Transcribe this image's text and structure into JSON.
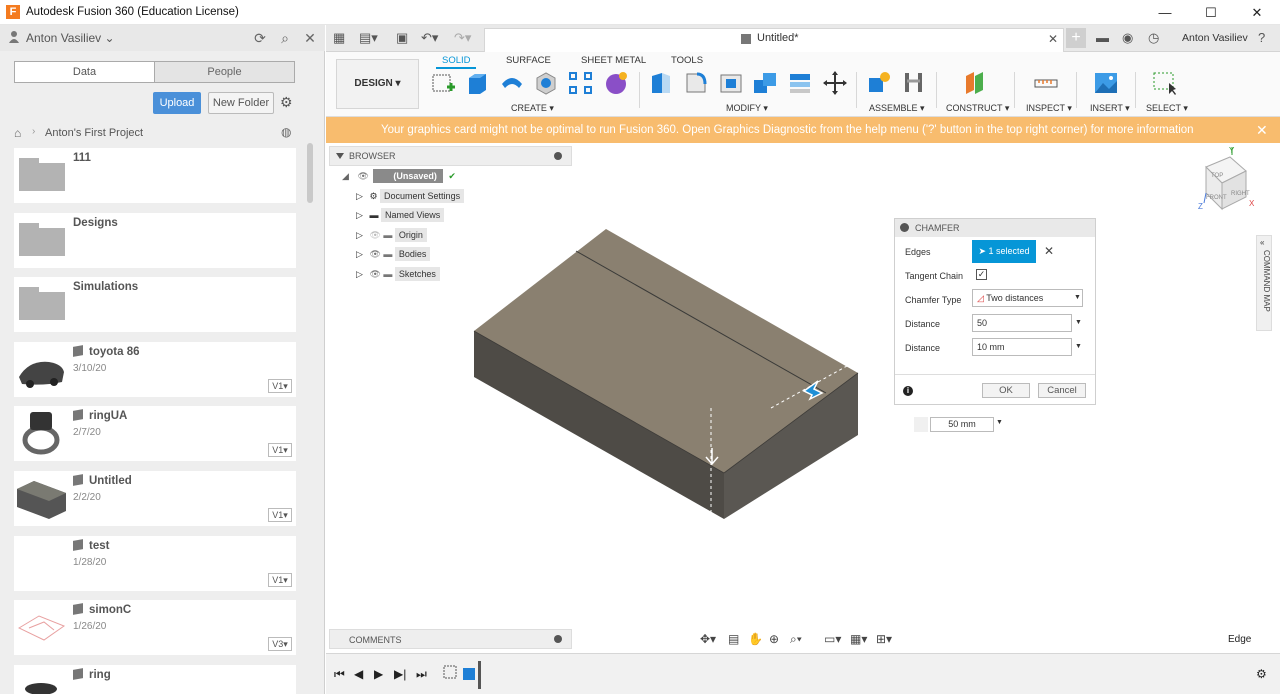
{
  "window": {
    "title": "Autodesk Fusion 360 (Education License)",
    "logo_letter": "F",
    "minimize": "—",
    "maximize": "☐",
    "close": "✕"
  },
  "left_panel": {
    "user": "Anton Vasiliev",
    "tabs": {
      "data": "Data",
      "people": "People"
    },
    "upload_label": "Upload",
    "new_folder_label": "New Folder",
    "breadcrumb": "Anton's First Project",
    "items": [
      {
        "name": "111",
        "date": "",
        "version": "",
        "kind": "folder"
      },
      {
        "name": "Designs",
        "date": "",
        "version": "",
        "kind": "folder"
      },
      {
        "name": "Simulations",
        "date": "",
        "version": "",
        "kind": "folder"
      },
      {
        "name": "toyota 86",
        "date": "3/10/20",
        "version": "V1",
        "kind": "design"
      },
      {
        "name": "ringUA",
        "date": "2/7/20",
        "version": "V1",
        "kind": "design"
      },
      {
        "name": "Untitled",
        "date": "2/2/20",
        "version": "V1",
        "kind": "design"
      },
      {
        "name": "test",
        "date": "1/28/20",
        "version": "V1",
        "kind": "design"
      },
      {
        "name": "simonC",
        "date": "1/26/20",
        "version": "V3",
        "kind": "design"
      },
      {
        "name": "ring",
        "date": "",
        "version": "",
        "kind": "design"
      }
    ]
  },
  "tabbar": {
    "doc_title": "Untitled*",
    "doc_close": "✕",
    "plus": "+",
    "user": "Anton Vasiliev"
  },
  "toolbar": {
    "workspace": "DESIGN ▾",
    "ribbon_tabs": [
      "SOLID",
      "SURFACE",
      "SHEET METAL",
      "TOOLS"
    ],
    "groups": [
      "CREATE ▾",
      "MODIFY ▾",
      "ASSEMBLE ▾",
      "CONSTRUCT ▾",
      "INSPECT ▾",
      "INSERT ▾",
      "SELECT ▾"
    ]
  },
  "warning": {
    "message": "Your graphics card might not be optimal to run Fusion 360. Open Graphics Diagnostic from the help menu ('?' button in the top right corner) for more information",
    "close": "✕"
  },
  "browser": {
    "title": "BROWSER",
    "root": "(Unsaved)",
    "nodes": [
      "Document Settings",
      "Named Views",
      "Origin",
      "Bodies",
      "Sketches"
    ],
    "comments": "COMMENTS"
  },
  "chamfer": {
    "title": "CHAMFER",
    "edges_label": "Edges",
    "edges_value": "1 selected",
    "tangent_label": "Tangent Chain",
    "tangent_checked": "✓",
    "type_label": "Chamfer Type",
    "type_value": "Two distances",
    "distance1_label": "Distance",
    "distance1_value": "50",
    "distance2_label": "Distance",
    "distance2_value": "10 mm",
    "ok": "OK",
    "cancel": "Cancel",
    "info": "i"
  },
  "viewport": {
    "dimension_input": "50 mm",
    "command_map": "COMMAND MAP",
    "selection_filter": "Edge",
    "viewcube_labels": {
      "top": "TOP",
      "front": "FRONT",
      "right": "RIGHT",
      "x": "X",
      "y": "Y",
      "z": "Z"
    }
  },
  "colors": {
    "accent": "#0696d7",
    "warning_bg": "#f8bc6e",
    "upload_bg": "#4a90d9",
    "body_top": "#8a8070",
    "body_side": "#55524d"
  }
}
